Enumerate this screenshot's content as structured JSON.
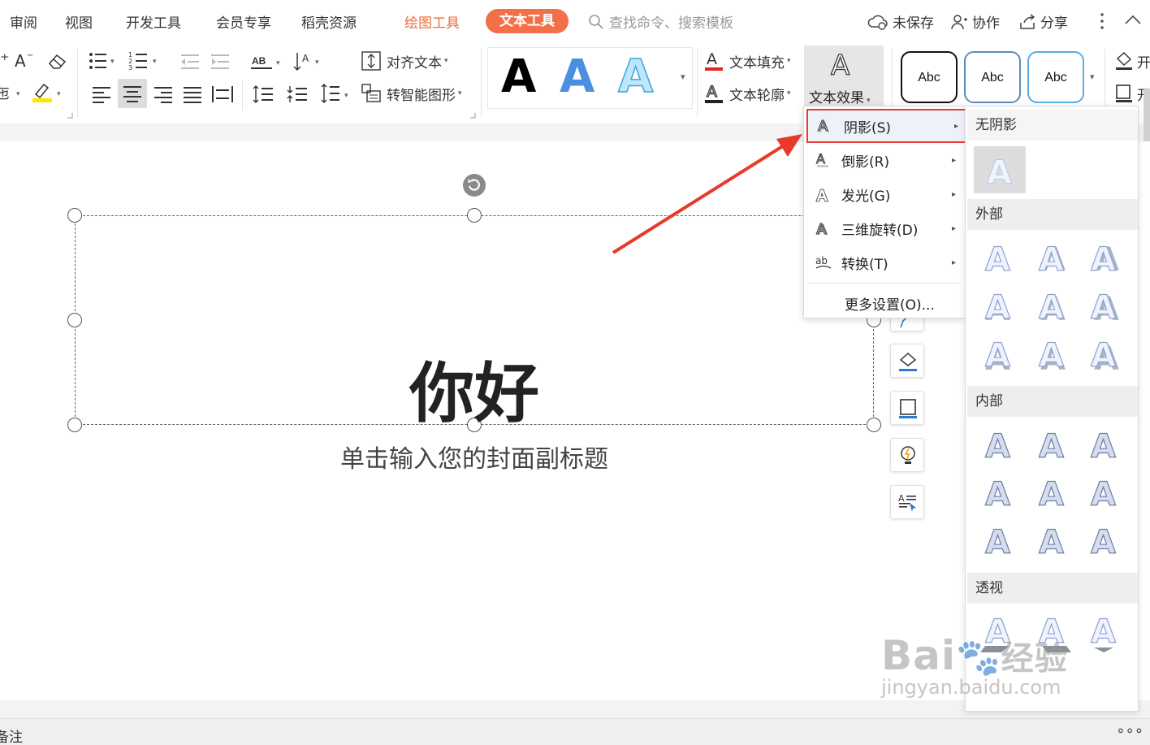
{
  "menu_tabs": [
    "审阅",
    "视图",
    "开发工具",
    "会员专享",
    "稻壳资源",
    "绘图工具",
    "文本工具"
  ],
  "search_placeholder": "查找命令、搜索模板",
  "top_right": {
    "unsaved": "未保存",
    "collab": "协作",
    "share": "分享"
  },
  "ribbon": {
    "align_text": "对齐文本",
    "smart_shape": "转智能图形",
    "text_fill": "文本填充",
    "text_outline": "文本轮廓",
    "text_effect": "文本效果",
    "abc": [
      "Abc",
      "Abc",
      "Abc"
    ],
    "ab_label": "AB",
    "right_edge_a": "开",
    "right_edge_b": "开"
  },
  "slide": {
    "title": "你好",
    "subtitle": "单击输入您的封面副标题"
  },
  "bottom": {
    "notes": "备注",
    "more": "∘∘∘"
  },
  "effect_menu": {
    "items": [
      {
        "label": "阴影(S)",
        "icon": "shadow-a-icon"
      },
      {
        "label": "倒影(R)",
        "icon": "reflection-a-icon"
      },
      {
        "label": "发光(G)",
        "icon": "glow-a-icon"
      },
      {
        "label": "三维旋转(D)",
        "icon": "3d-rotate-a-icon"
      },
      {
        "label": "转换(T)",
        "icon": "transform-ab-icon"
      }
    ],
    "more": "更多设置(O)..."
  },
  "shadow_submenu": {
    "no_shadow": "无阴影",
    "outer": "外部",
    "inner": "内部",
    "perspective": "透视",
    "glyph": "A"
  },
  "watermark": {
    "brand": "Bai",
    "jingyan": "经验",
    "url": "jingyan.baidu.com"
  },
  "colors": {
    "accent": "#f26f48",
    "highlight_border": "#e33b30",
    "arrow": "#e8392a",
    "style_blue": "#4a8fe0"
  }
}
